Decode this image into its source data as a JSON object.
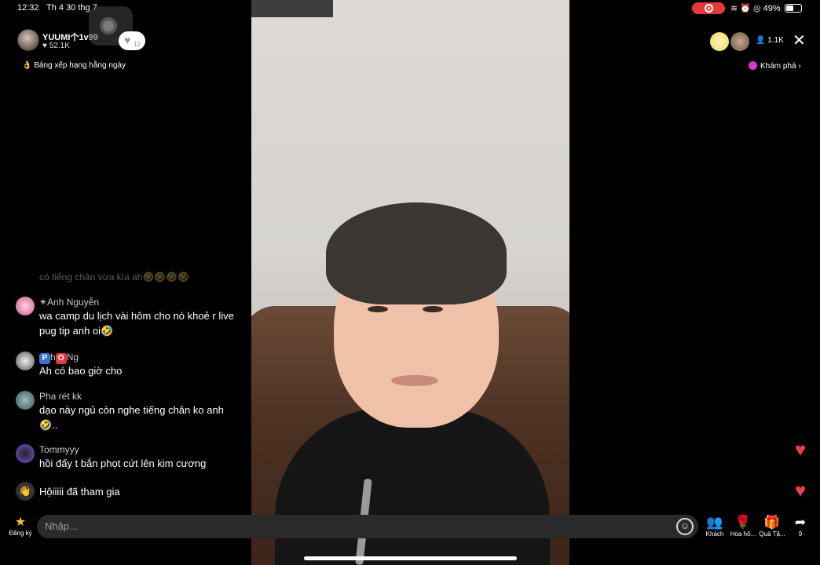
{
  "status": {
    "time": "12:32",
    "date": "Th 4 30 thg 7",
    "icons": "≋ ⏰ ◎ 49%"
  },
  "host": {
    "name": "YUUMI个1v99",
    "likes": "♥ 52.1K",
    "follow_count": "12"
  },
  "rank_label": "👌 Bảng xếp hạng hằng ngày",
  "viewers": "👤 1.1K",
  "explore_label": "Khám phá ›",
  "chat": {
    "faded_message": "có tiếng chân vừa kìa ah🤣🤣🤣🤣",
    "messages": [
      {
        "user": "✴Anh Nguyễn",
        "text": "wa camp du lịch vài hôm cho nó khoẻ r live pug tip anh oi🤣"
      },
      {
        "user_badge_p": "P",
        "user_mid": "h",
        "user_badge_o": "O",
        "user_end": "Ng",
        "text": "Ah có bao giờ cho"
      },
      {
        "user": "Pha rét kk",
        "text": "dạo này ngủ còn nghe tiếng chân ko anh 🤣.."
      },
      {
        "user": "Tommyyy",
        "text": "hồi đấy t bắn phọt cứt lên kim cương"
      },
      {
        "user": "Hộiiiii",
        "text": "đã tham gia"
      }
    ]
  },
  "bottom": {
    "signup_label": "Đăng ký",
    "input_placeholder": "Nhập...",
    "guest_label": "Khách",
    "flower_label": "Hoa hồ...",
    "gift_label": "Quà Tặ...",
    "share_count": "9"
  },
  "icons": {
    "heart": "♥",
    "close": "✕",
    "emoji": "☺",
    "guests": "👥",
    "rose": "🌹",
    "gift": "🎁",
    "share": "➦",
    "signup": "★"
  },
  "colors": {
    "heart": "#ef3b4d",
    "record": "#e03a3a",
    "explore_dot": "#d63ac6"
  }
}
